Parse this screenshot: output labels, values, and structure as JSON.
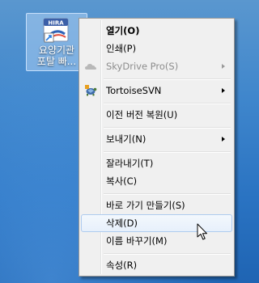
{
  "desktop": {
    "icon": {
      "badge_text": "HIRA",
      "label_line1": "요양기관",
      "label_line2": "포탈 빠..."
    }
  },
  "context_menu": {
    "items": [
      {
        "label": "열기(O)"
      },
      {
        "label": "인쇄(P)"
      },
      {
        "label": "SkyDrive Pro(S)"
      },
      {
        "label": "TortoiseSVN"
      },
      {
        "label": "이전 버전 복원(U)"
      },
      {
        "label": "보내기(N)"
      },
      {
        "label": "잘라내기(T)"
      },
      {
        "label": "복사(C)"
      },
      {
        "label": "바로 가기 만들기(S)"
      },
      {
        "label": "삭제(D)"
      },
      {
        "label": "이름 바꾸기(M)"
      },
      {
        "label": "속성(R)"
      }
    ]
  },
  "colors": {
    "desktop_bg": "#3f86cc",
    "menu_bg": "#f0f0f0",
    "hover_border": "#aecbef",
    "disabled_text": "#8d8d8d"
  },
  "icons": [
    "hira-shortcut-icon",
    "skydrive-cloud-icon",
    "tortoisesvn-turtle-icon",
    "mouse-cursor-icon"
  ]
}
